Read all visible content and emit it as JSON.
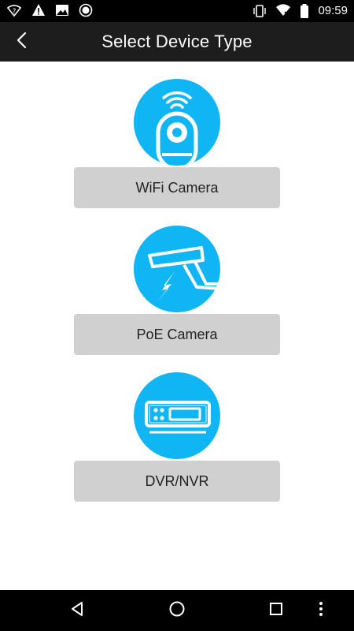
{
  "status_bar": {
    "time": "09:59",
    "left_icons": [
      "wifi-question-icon",
      "alert-icon",
      "image-icon",
      "record-icon"
    ],
    "right_icons": [
      "vibrate-icon",
      "signal-icon",
      "battery-icon"
    ]
  },
  "app_bar": {
    "title": "Select Device Type",
    "back_icon": "chevron-left-icon"
  },
  "device_types": [
    {
      "label": "WiFi Camera",
      "icon": "wifi-camera-icon"
    },
    {
      "label": "PoE Camera",
      "icon": "poe-camera-icon"
    },
    {
      "label": "DVR/NVR",
      "icon": "dvr-nvr-icon"
    }
  ],
  "colors": {
    "accent": "#10b5f4",
    "app_bar": "#1d1d1d",
    "button": "#d0d0d0",
    "system_bars": "#000000"
  },
  "nav_bar": {
    "buttons": [
      "back-triangle-icon",
      "home-circle-icon",
      "recents-square-icon",
      "more-dots-icon"
    ]
  }
}
